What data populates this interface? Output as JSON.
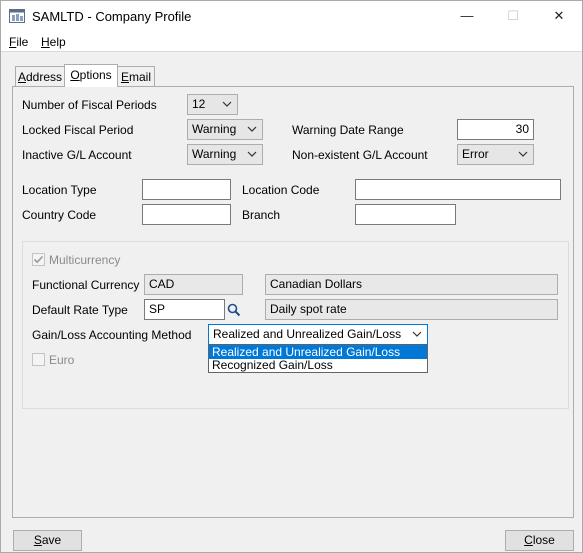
{
  "window": {
    "title": "SAMLTD - Company Profile",
    "min_glyph": "—",
    "max_glyph": "☐",
    "close_glyph": "✕"
  },
  "menu": {
    "file_u": "F",
    "file_rest": "ile",
    "help_u": "H",
    "help_rest": "elp"
  },
  "tabs": [
    {
      "label_u": "A",
      "label_rest": "ddress",
      "active": false
    },
    {
      "label_u": "O",
      "label_rest": "ptions",
      "active": true
    },
    {
      "label_u": "E",
      "label_rest": "mail",
      "active": false
    }
  ],
  "options": {
    "fiscal_periods_label": "Number of Fiscal Periods",
    "fiscal_periods_value": "12",
    "locked_period_label": "Locked Fiscal Period",
    "locked_period_value": "Warning",
    "warning_date_range_label": "Warning Date Range",
    "warning_date_range_value": "30",
    "inactive_gl_label": "Inactive G/L Account",
    "inactive_gl_value": "Warning",
    "nonexistent_gl_label": "Non-existent G/L Account",
    "nonexistent_gl_value": "Error",
    "location_type_label": "Location Type",
    "location_type_value": "",
    "location_code_label": "Location Code",
    "location_code_value": "",
    "country_code_label": "Country Code",
    "country_code_value": "",
    "branch_label": "Branch",
    "branch_value": ""
  },
  "currency": {
    "multicurrency_label": "Multicurrency",
    "multicurrency_checked": true,
    "functional_currency_label": "Functional Currency",
    "functional_currency_code": "CAD",
    "functional_currency_desc": "Canadian Dollars",
    "default_rate_type_label": "Default Rate Type",
    "default_rate_type_code": "SP",
    "default_rate_type_desc": "Daily spot rate",
    "gain_loss_label": "Gain/Loss Accounting Method",
    "gain_loss_value": "Realized and Unrealized Gain/Loss",
    "gain_loss_options": [
      "Realized and Unrealized Gain/Loss",
      "Recognized Gain/Loss"
    ],
    "euro_label": "Euro",
    "euro_checked": false
  },
  "buttons": {
    "save_u": "S",
    "save_rest": "ave",
    "close_u": "C",
    "close_rest": "lose"
  },
  "icons": {
    "finder": "magnifier-icon",
    "chevron": "chevron-down-icon"
  }
}
